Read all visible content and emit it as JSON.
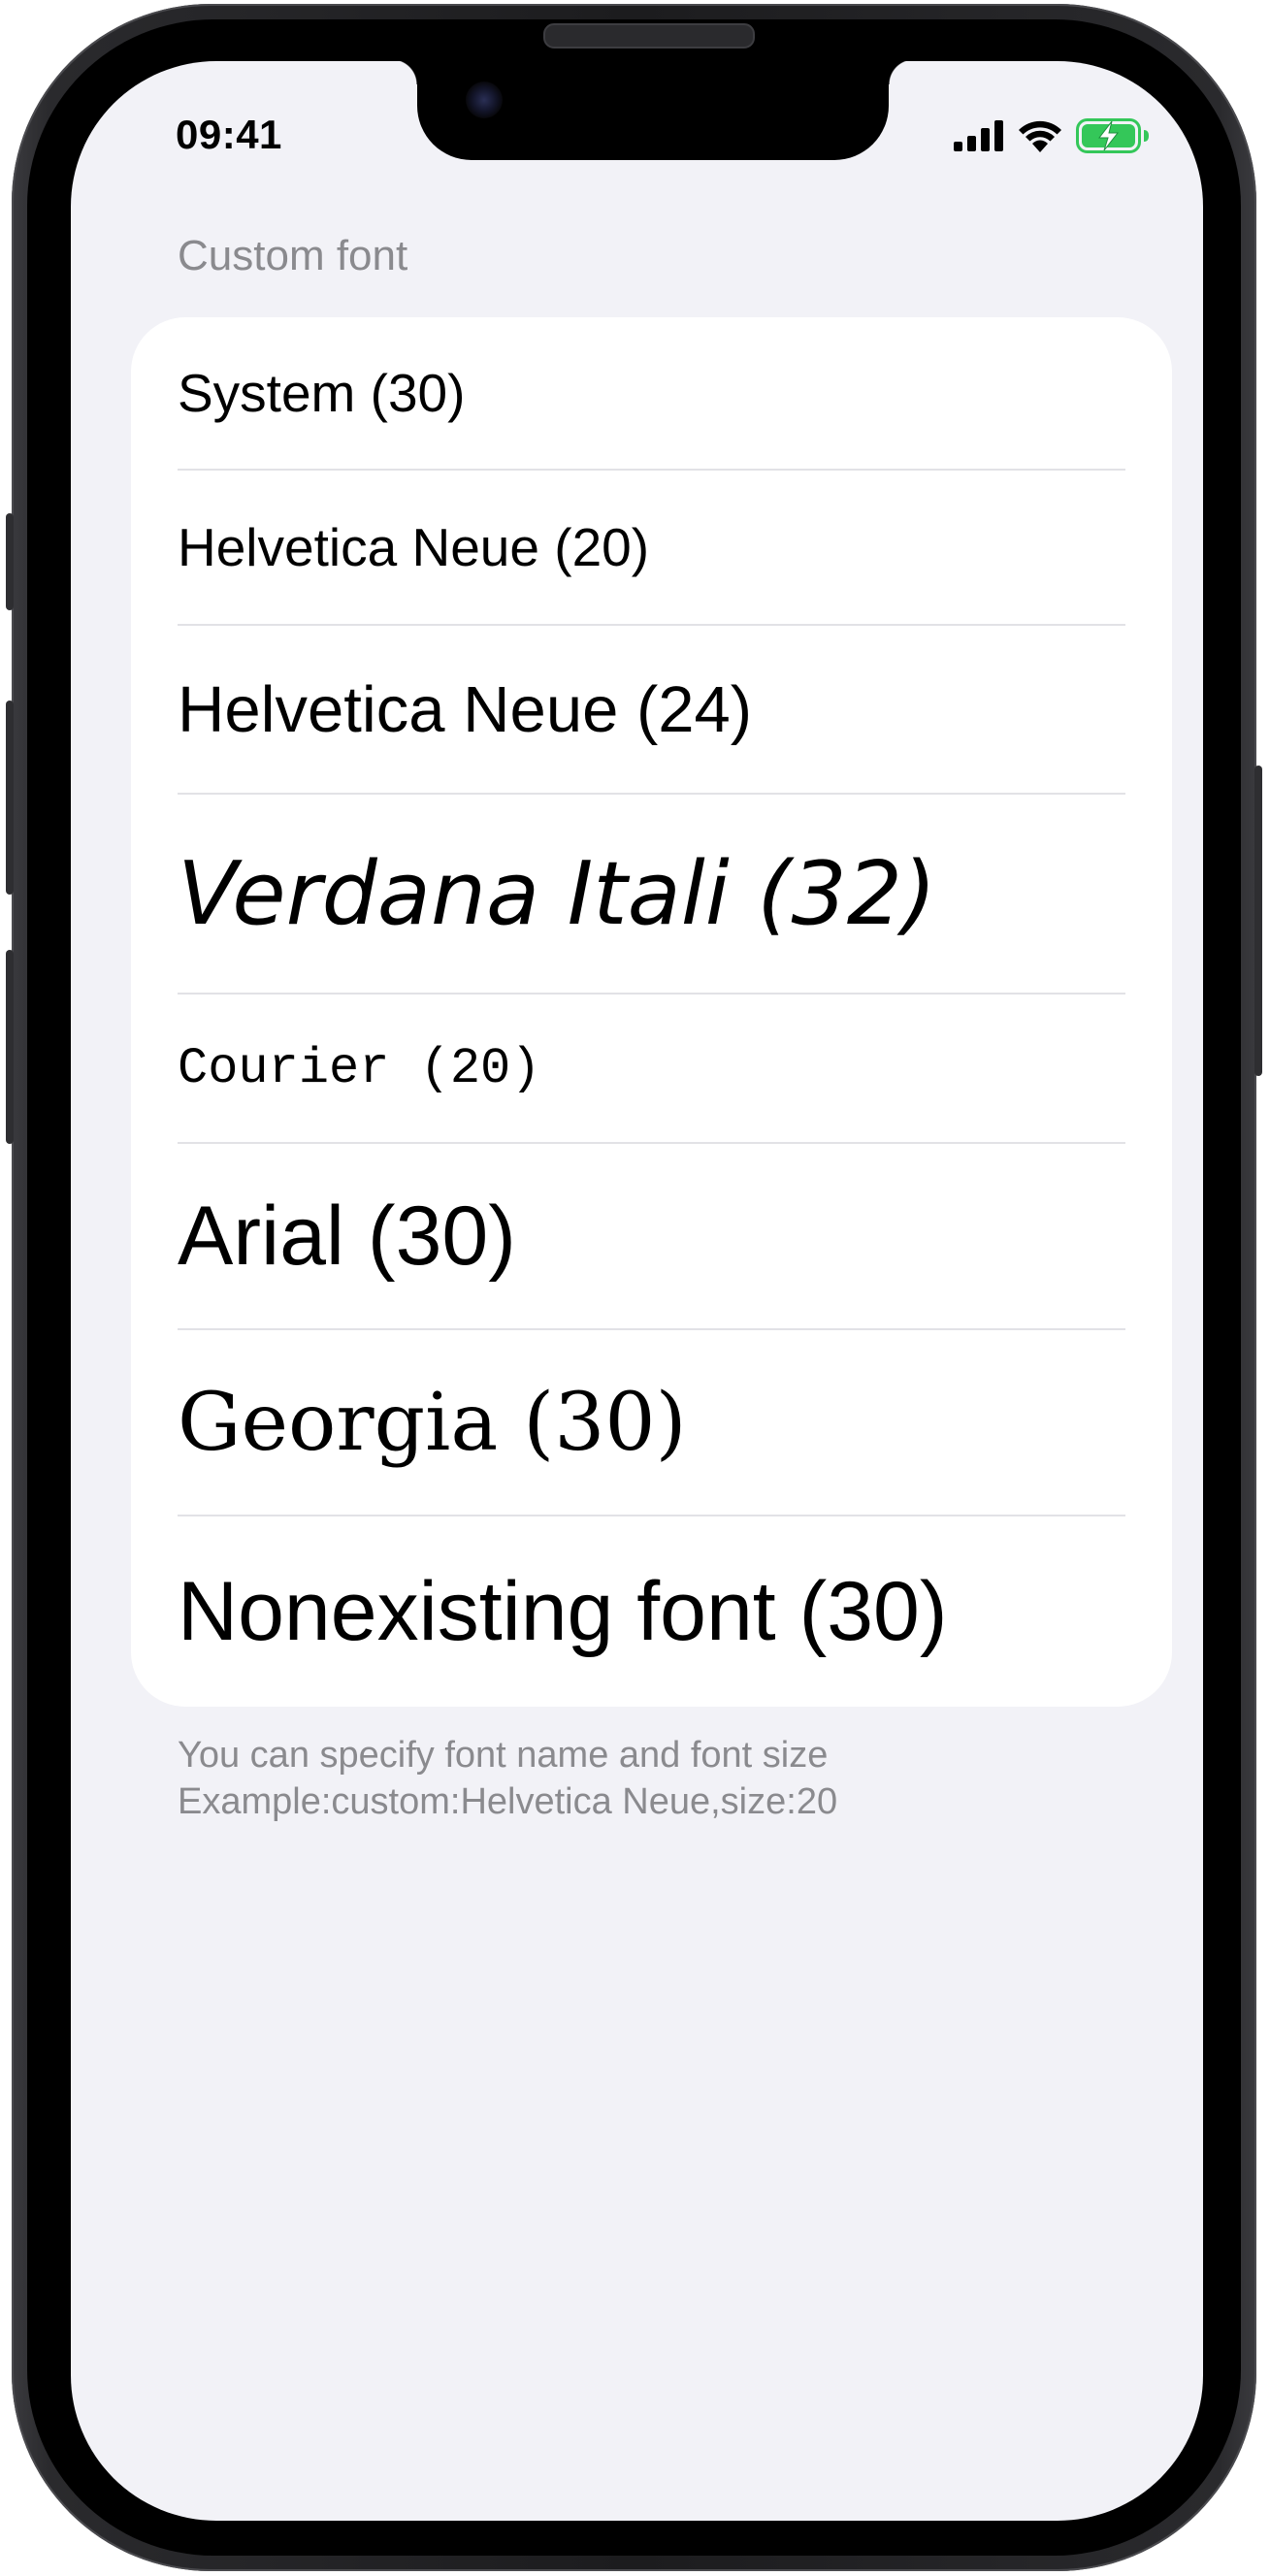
{
  "status_bar": {
    "time": "09:41",
    "icons": [
      "cellular-signal-icon",
      "wifi-icon",
      "battery-charging-icon"
    ],
    "battery_color": "#34c759"
  },
  "section": {
    "header": "Custom font",
    "footer_line1": "You can specify font name and font size",
    "footer_line2": "Example:custom:Helvetica Neue,size:20"
  },
  "font_rows": [
    {
      "label": "System (30)"
    },
    {
      "label": "Helvetica Neue (20)"
    },
    {
      "label": "Helvetica Neue (24)"
    },
    {
      "label": "Verdana Itali (32)"
    },
    {
      "label": "Courier (20)"
    },
    {
      "label": "Arial (30)"
    },
    {
      "label": "Georgia (30)"
    },
    {
      "label": "Nonexisting font (30)"
    }
  ],
  "colors": {
    "background": "#f2f2f7",
    "card": "#ffffff",
    "secondary_text": "#8a8a8e",
    "separator": "#e2e2e6"
  }
}
